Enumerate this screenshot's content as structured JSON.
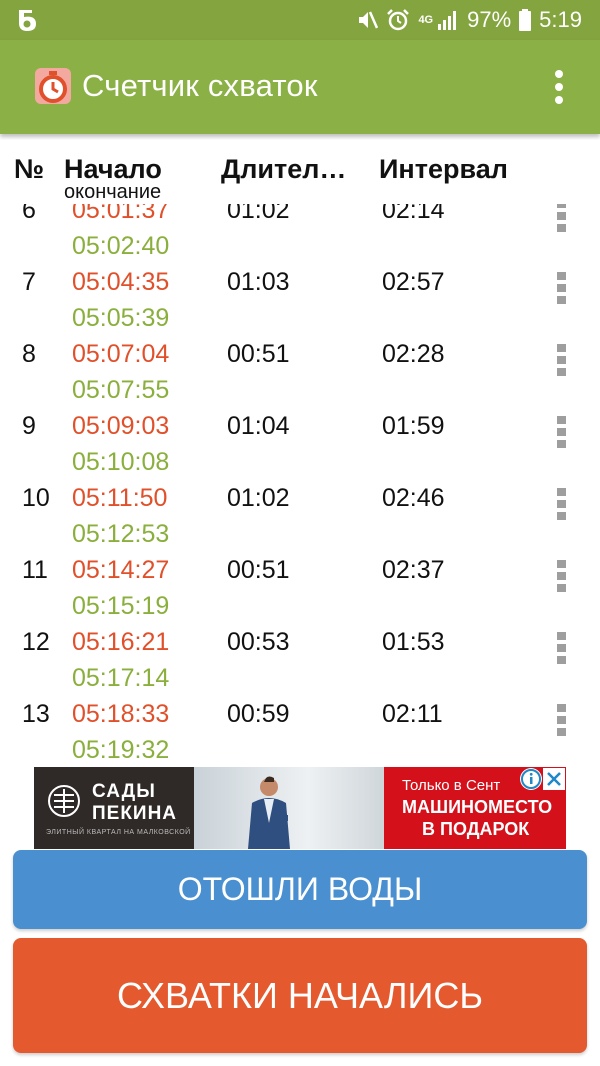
{
  "status_bar": {
    "network": "4G",
    "battery": "97%",
    "time": "5:19",
    "icons": [
      "app-notification-icon",
      "mute-icon",
      "alarm-icon",
      "network-4g-icon",
      "signal-icon",
      "battery-icon"
    ]
  },
  "app_bar": {
    "title": "Счетчик схваток",
    "logo_icon": "stopwatch-logo-icon",
    "menu_icon": "overflow-menu-icon"
  },
  "table": {
    "headers": {
      "number": "№",
      "start": "Начало",
      "end": "окончание",
      "duration": "Длител…",
      "interval": "Интервал"
    },
    "rows": [
      {
        "num": "6",
        "start": "05:01:37",
        "end": "05:02:40",
        "duration": "01:02",
        "interval": "02:14"
      },
      {
        "num": "7",
        "start": "05:04:35",
        "end": "05:05:39",
        "duration": "01:03",
        "interval": "02:57"
      },
      {
        "num": "8",
        "start": "05:07:04",
        "end": "05:07:55",
        "duration": "00:51",
        "interval": "02:28"
      },
      {
        "num": "9",
        "start": "05:09:03",
        "end": "05:10:08",
        "duration": "01:04",
        "interval": "01:59"
      },
      {
        "num": "10",
        "start": "05:11:50",
        "end": "05:12:53",
        "duration": "01:02",
        "interval": "02:46"
      },
      {
        "num": "11",
        "start": "05:14:27",
        "end": "05:15:19",
        "duration": "00:51",
        "interval": "02:37"
      },
      {
        "num": "12",
        "start": "05:16:21",
        "end": "05:17:14",
        "duration": "00:53",
        "interval": "01:53"
      },
      {
        "num": "13",
        "start": "05:18:33",
        "end": "05:19:32",
        "duration": "00:59",
        "interval": "02:11"
      }
    ]
  },
  "ad": {
    "brand": [
      "САДЫ",
      "ПЕКИНА"
    ],
    "tagline": "ЭЛИТНЫЙ КВАРТАЛ НА МАЛКОВСКОЙ",
    "top_text": "Только в Сент",
    "line1": "МАШИНОМЕСТО",
    "line2": "В ПОДАРОК",
    "info_icon": "ad-info-icon",
    "close_icon": "ad-close-icon"
  },
  "buttons": {
    "water": "ОТОШЛИ ВОДЫ",
    "contractions": "СХВАТКИ НАЧАЛИСЬ"
  },
  "colors": {
    "status_bar": "#83a43f",
    "app_bar": "#8bb045",
    "start_time": "#e0502a",
    "end_time": "#8aaf3c",
    "water_button": "#4a90d0",
    "contractions_button": "#e4592e"
  }
}
